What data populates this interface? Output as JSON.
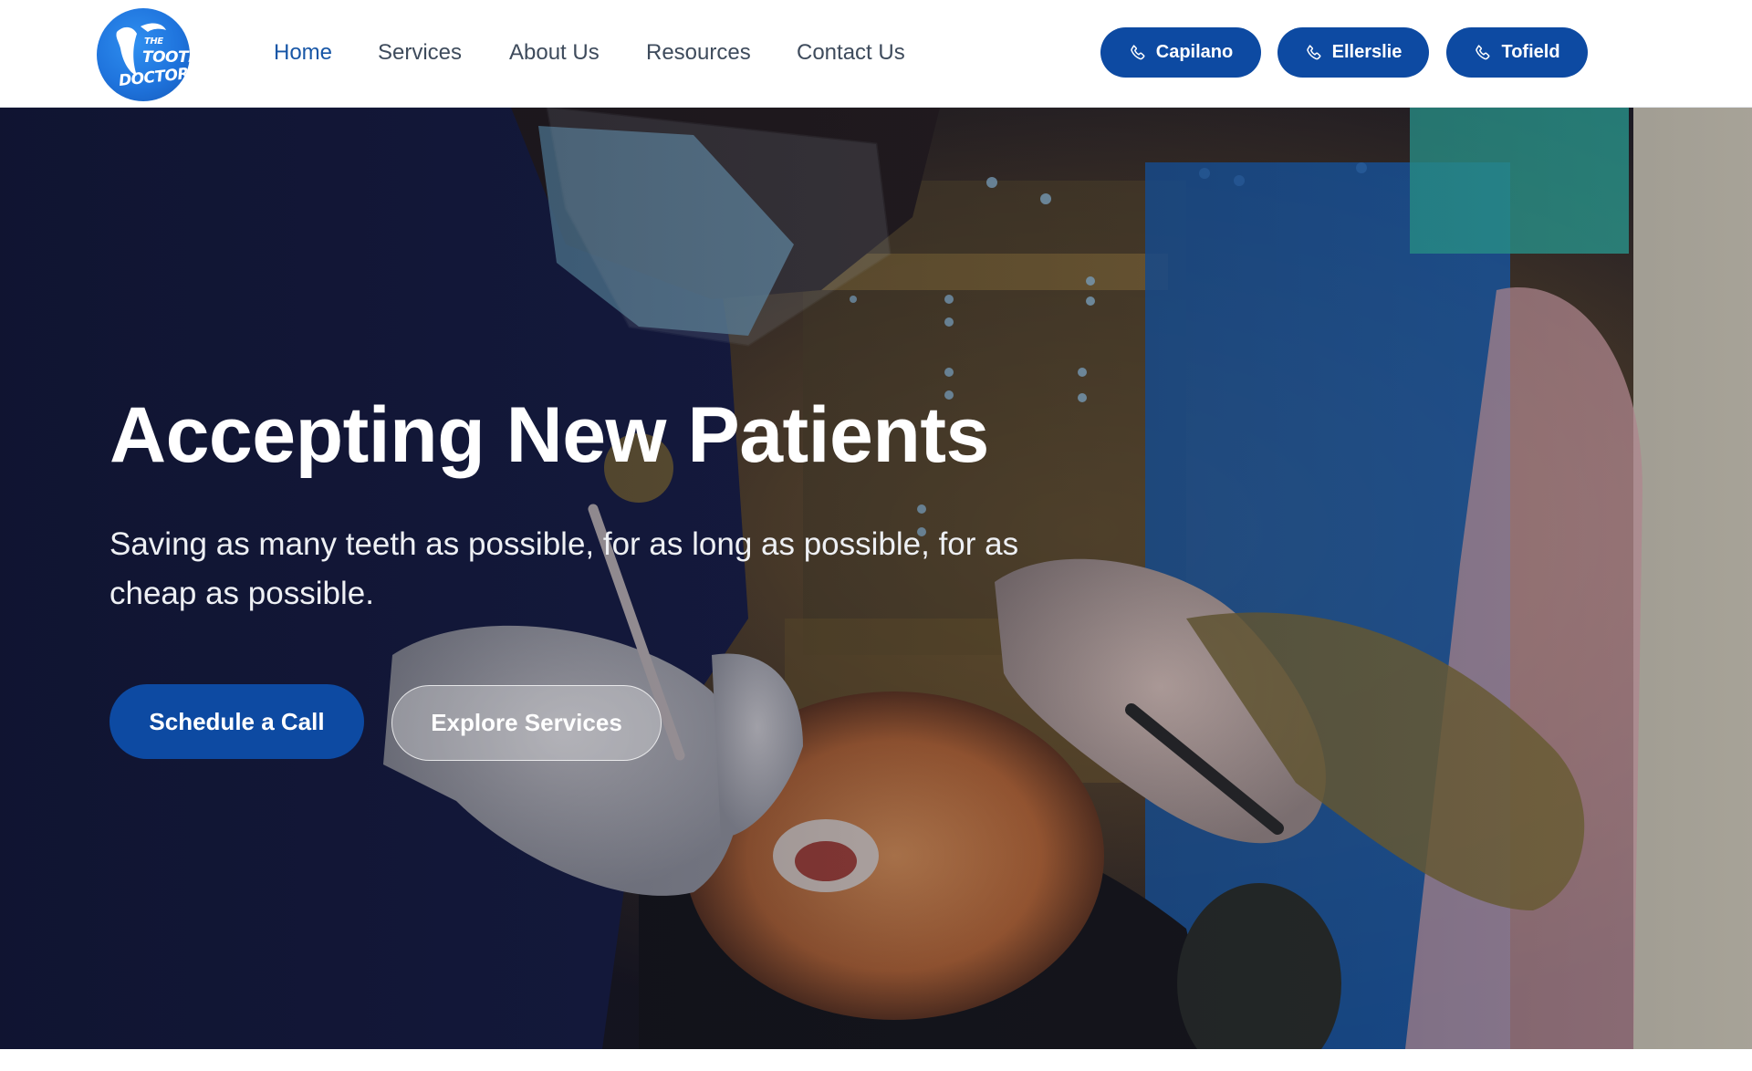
{
  "brand": {
    "logo_text_lines": [
      "THE",
      "TOOTH",
      "DOCTOR"
    ],
    "logo_color": "#1f74dd"
  },
  "nav": {
    "items": [
      {
        "label": "Home",
        "active": true
      },
      {
        "label": "Services",
        "active": false
      },
      {
        "label": "About Us",
        "active": false
      },
      {
        "label": "Resources",
        "active": false
      },
      {
        "label": "Contact Us",
        "active": false
      }
    ],
    "active_color": "#1756a6",
    "text_color": "#3e4b5c"
  },
  "call_buttons": [
    {
      "label": "Capilano",
      "icon": "phone-icon"
    },
    {
      "label": "Ellerslie",
      "icon": "phone-icon"
    },
    {
      "label": "Tofield",
      "icon": "phone-icon"
    }
  ],
  "hero": {
    "title": "Accepting New Patients",
    "subtitle": "Saving as many teeth as possible, for as long as possible, for as cheap as possible.",
    "primary_cta": "Schedule a Call",
    "secondary_cta": "Explore Services",
    "background": "dentist-treating-patient-photo"
  },
  "colors": {
    "accent": "#0d4aa2",
    "header_bg": "#ffffff"
  }
}
